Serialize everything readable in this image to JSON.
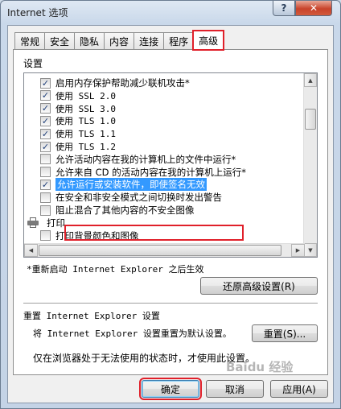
{
  "window": {
    "title": "Internet 选项",
    "help_glyph": "?",
    "close_glyph": "✕"
  },
  "tabs": [
    {
      "label": "常规"
    },
    {
      "label": "安全"
    },
    {
      "label": "隐私"
    },
    {
      "label": "内容"
    },
    {
      "label": "连接"
    },
    {
      "label": "程序"
    },
    {
      "label": "高级"
    }
  ],
  "active_tab": "高级",
  "settings": {
    "label": "设置",
    "items": [
      {
        "checked": true,
        "text": "启用内存保护帮助减少联机攻击*",
        "mono": false
      },
      {
        "checked": true,
        "text": "使用 SSL 2.0",
        "mono": true
      },
      {
        "checked": true,
        "text": "使用 SSL 3.0",
        "mono": true
      },
      {
        "checked": true,
        "text": "使用 TLS 1.0",
        "mono": true
      },
      {
        "checked": true,
        "text": "使用 TLS 1.1",
        "mono": true
      },
      {
        "checked": true,
        "text": "使用 TLS 1.2",
        "mono": true
      },
      {
        "checked": false,
        "text": "允许活动内容在我的计算机上的文件中运行*",
        "mono": false
      },
      {
        "checked": false,
        "text": "允许来自 CD 的活动内容在我的计算机上运行*",
        "mono": false
      },
      {
        "checked": true,
        "text": "允许运行或安装软件，即使签名无效",
        "mono": false,
        "selected": true
      },
      {
        "checked": false,
        "text": "在安全和非安全模式之间切换时发出警告",
        "mono": false
      },
      {
        "checked": false,
        "text": "阻止混合了其他内容的不安全图像",
        "mono": false
      },
      {
        "group": true,
        "icon": "printer-icon",
        "text": "打印"
      },
      {
        "checked": false,
        "text": "打印背景颜色和图像",
        "mono": false
      }
    ]
  },
  "restart_note": "*重新启动 Internet Explorer 之后生效",
  "restore_button": "还原高级设置(R)",
  "reset_section": {
    "title": "重置 Internet Explorer 设置",
    "description": "将 Internet Explorer 设置重置为默认设置。",
    "button": "重置(S)...",
    "note": "仅在浏览器处于无法使用的状态时，才使用此设置。"
  },
  "footer": {
    "ok": "确定",
    "cancel": "取消",
    "apply": "应用(A)"
  },
  "watermark": "Baidu 经验",
  "colors": {
    "highlight_red": "#e0202a",
    "selection_blue": "#3399ff"
  }
}
